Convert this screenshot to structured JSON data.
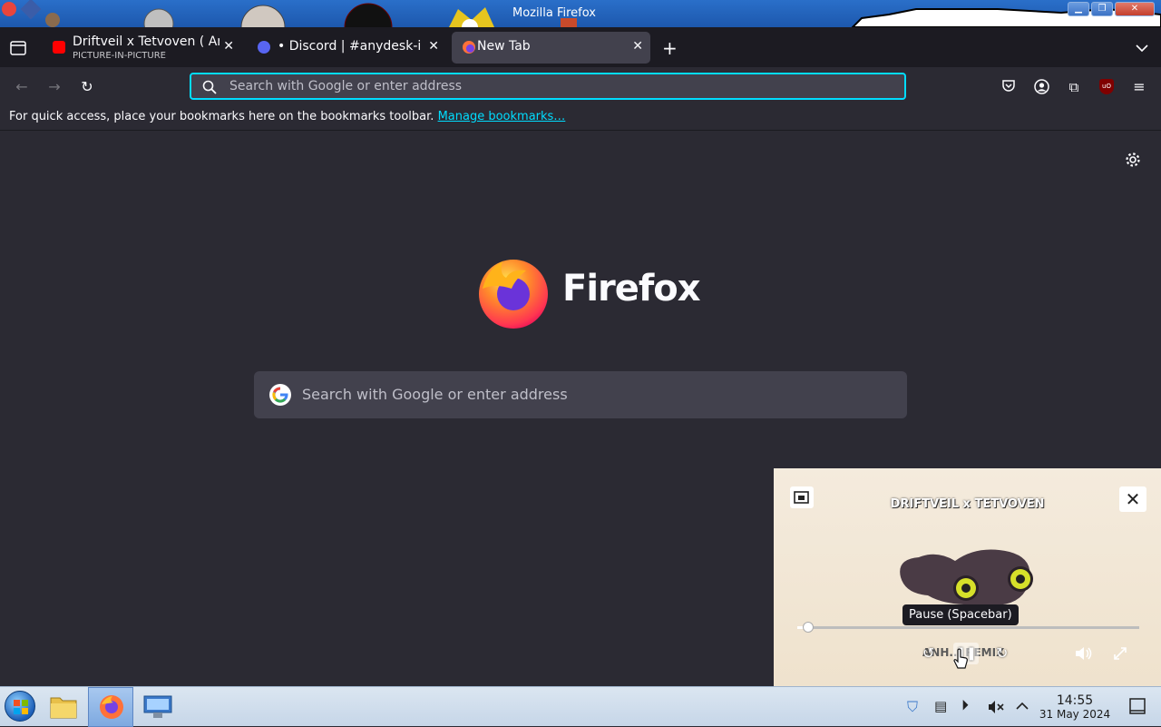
{
  "window": {
    "title": "Mozilla Firefox",
    "minimize_icon": "minimize-icon",
    "maximize_icon": "maximize-icon",
    "close_icon": "close-icon"
  },
  "tabs": [
    {
      "label": "Driftveil x Tetvoven ( Anh",
      "sub": "PICTURE-IN-PICTURE",
      "favicon": "youtube-icon",
      "active": false
    },
    {
      "label": "• Discord | #anydesk-id",
      "favicon": "discord-icon",
      "active": false
    },
    {
      "label": "New Tab",
      "favicon": "firefox-icon",
      "active": true
    }
  ],
  "toolbar": {
    "url_placeholder": "Search with Google or enter address",
    "icons": [
      "back-icon",
      "forward-icon",
      "reload-icon",
      "pocket-icon",
      "account-icon",
      "extensions-icon",
      "ublock-icon",
      "menu-icon"
    ]
  },
  "bookmarks": {
    "message": "For quick access, place your bookmarks here on the bookmarks toolbar.",
    "link": "Manage bookmarks…"
  },
  "newtab": {
    "brand": "Firefox",
    "search_placeholder": "Search with Google or enter address"
  },
  "pip": {
    "video_title": "DRIFTVEIL x TETVOVEN",
    "tooltip": "Pause (Spacebar)",
    "caption": "ANH... REMIX",
    "progress": 0.02
  },
  "taskbar": {
    "time": "14:55",
    "date": "31 May 2024"
  }
}
